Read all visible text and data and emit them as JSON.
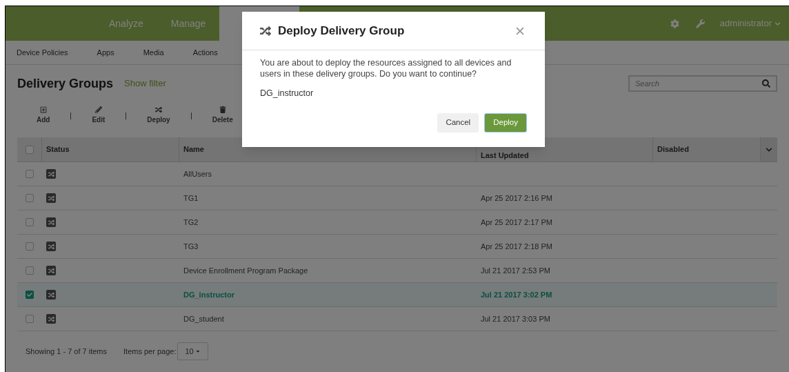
{
  "top_nav": {
    "tabs": [
      {
        "label": "Analyze",
        "selected": false
      },
      {
        "label": "Manage",
        "selected": false
      },
      {
        "selected": true
      }
    ],
    "user": "administrator"
  },
  "sub_nav": [
    "Device Policies",
    "Apps",
    "Media",
    "Actions"
  ],
  "page": {
    "title": "Delivery Groups",
    "filter_link": "Show filter",
    "search": {
      "placeholder": "Search"
    }
  },
  "toolbar": [
    {
      "kind": "add",
      "label": "Add"
    },
    {
      "kind": "edit",
      "label": "Edit"
    },
    {
      "kind": "deploy",
      "label": "Deploy"
    },
    {
      "kind": "delete",
      "label": "Delete"
    }
  ],
  "table": {
    "all_selected": false,
    "columns": [
      "Status",
      "Name",
      "Last Updated",
      "Disabled"
    ],
    "rows": [
      {
        "name": "AllUsers",
        "last_updated": "",
        "selected": false
      },
      {
        "name": "TG1",
        "last_updated": "Apr 25 2017 2:16 PM",
        "selected": false
      },
      {
        "name": "TG2",
        "last_updated": "Apr 25 2017 2:17 PM",
        "selected": false
      },
      {
        "name": "TG3",
        "last_updated": "Apr 25 2017 2:18 PM",
        "selected": false
      },
      {
        "name": "Device Enrollment Program Package",
        "last_updated": "Jul 21 2017 2:53 PM",
        "selected": false
      },
      {
        "name": "DG_instructor",
        "last_updated": "Jul 21 2017 3:02 PM",
        "selected": true
      },
      {
        "name": "DG_student",
        "last_updated": "Jul 21 2017 3:03 PM",
        "selected": false
      }
    ]
  },
  "pagination": {
    "summary": "Showing 1 - 7 of 7 items",
    "per_page_label": "Items per page:",
    "per_page": "10"
  },
  "dialog": {
    "title": "Deploy Delivery Group",
    "message": "You are about to deploy the resources assigned to all devices and users in these delivery groups. Do you want to continue?",
    "item": "DG_instructor",
    "buttons": [
      "Cancel",
      "Deploy"
    ]
  }
}
